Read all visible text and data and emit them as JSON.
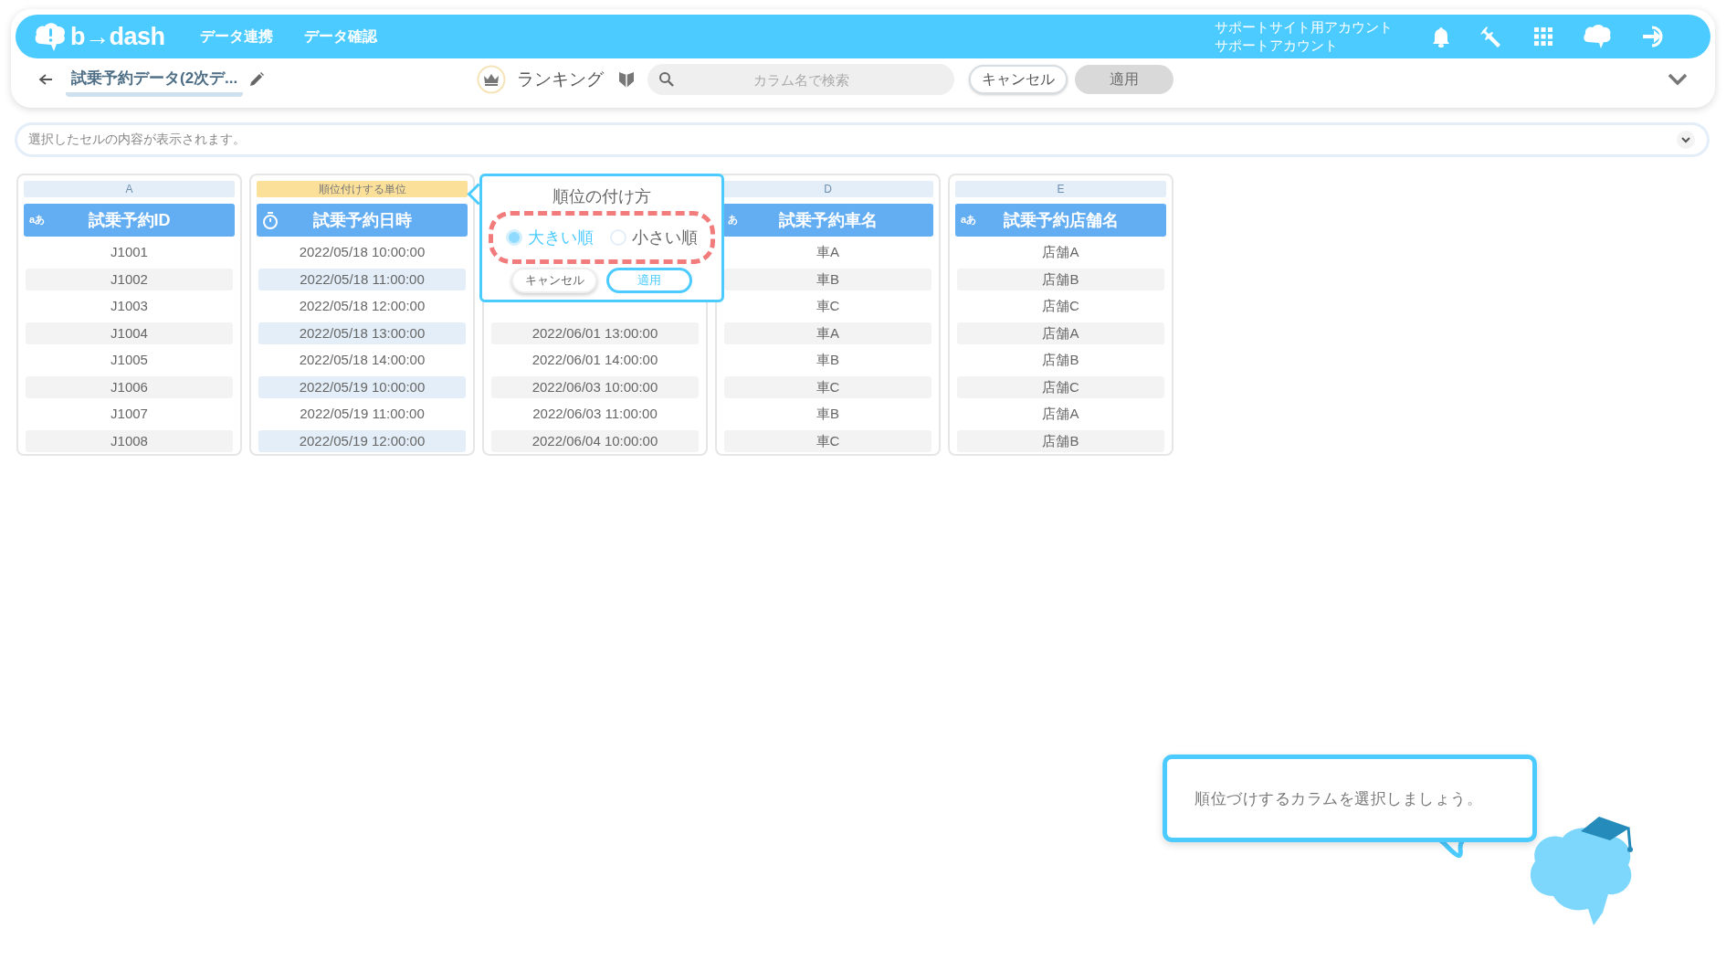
{
  "app": {
    "logo": "b→dash",
    "nav": [
      {
        "label": "データ連携"
      },
      {
        "label": "データ確認"
      }
    ],
    "account": {
      "line1": "サポートサイト用アカウント",
      "line2": "サポートアカウント"
    }
  },
  "toolbar": {
    "dataset_title": "試乗予約データ(2次デ...",
    "mode": "ランキング",
    "search": {
      "placeholder": "カラム名で検索"
    },
    "buttons": [
      {
        "label": "キャンセル",
        "kind": "outline",
        "disabled": false
      },
      {
        "label": "適用",
        "kind": "filled",
        "disabled": true
      }
    ]
  },
  "cell_bar": {
    "placeholder": "選択したセルの内容が表示されます。"
  },
  "columns": [
    {
      "letter": "A",
      "kind": "text",
      "type_label": "aあ",
      "name": "試乗予約ID",
      "selected": false,
      "rows": [
        "J1001",
        "J1002",
        "J1003",
        "J1004",
        "J1005",
        "J1006",
        "J1007",
        "J1008"
      ]
    },
    {
      "tag": "順位付けする単位",
      "kind": "datetime",
      "name": "試乗予約日時",
      "selected": true,
      "rows": [
        "2022/05/18 10:00:00",
        "2022/05/18 11:00:00",
        "2022/05/18 12:00:00",
        "2022/05/18 13:00:00",
        "2022/05/18 14:00:00",
        "2022/05/19 10:00:00",
        "2022/05/19 11:00:00",
        "2022/05/19 12:00:00"
      ]
    },
    {
      "selected": false,
      "rows": [
        "2022/06/01 13:00:00",
        "2022/06/01 14:00:00",
        "2022/06/03 10:00:00",
        "2022/06/03 11:00:00",
        "2022/06/04 10:00:00"
      ]
    },
    {
      "letter": "D",
      "kind": "text",
      "type_label": "あ",
      "name": "試乗予約車名",
      "selected": false,
      "rows": [
        "車A",
        "車B",
        "車C",
        "車A",
        "車B",
        "車C",
        "車B",
        "車C"
      ]
    },
    {
      "letter": "E",
      "kind": "text",
      "type_label": "aあ",
      "name": "試乗予約店舗名",
      "selected": false,
      "rows": [
        "店舗A",
        "店舗B",
        "店舗C",
        "店舗A",
        "店舗B",
        "店舗C",
        "店舗A",
        "店舗B"
      ]
    }
  ],
  "popup": {
    "title": "順位の付け方",
    "options": [
      {
        "label": "大きい順",
        "selected": true
      },
      {
        "label": "小さい順",
        "selected": false
      }
    ],
    "buttons": [
      {
        "label": "キャンセル",
        "kind": "secondary"
      },
      {
        "label": "適用",
        "kind": "primary"
      }
    ]
  },
  "hint": {
    "text": "順位づけするカラムを選択しましょう。"
  }
}
